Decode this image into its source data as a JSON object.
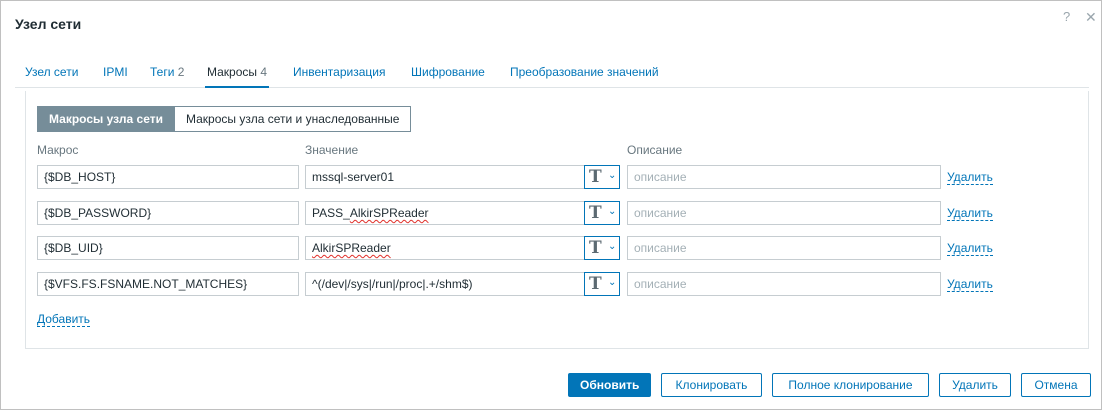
{
  "dialog": {
    "title": "Узел сети",
    "help_icon": "?",
    "close_icon": "✕"
  },
  "tabs": [
    {
      "label": "Узел сети"
    },
    {
      "label": "IPMI"
    },
    {
      "label": "Теги",
      "count": "2"
    },
    {
      "label": "Макросы",
      "count": "4",
      "active": true
    },
    {
      "label": "Инвентаризация"
    },
    {
      "label": "Шифрование"
    },
    {
      "label": "Преобразование значений"
    }
  ],
  "segmented": {
    "host_macros": "Макросы узла сети",
    "inherited_macros": "Макросы узла сети и унаследованные"
  },
  "columns": {
    "macro": "Макрос",
    "value": "Значение",
    "description": "Описание"
  },
  "rows": [
    {
      "macro": "{$DB_HOST}",
      "value": "mssql-server01",
      "description_placeholder": "описание",
      "remove": "Удалить"
    },
    {
      "macro": "{$DB_PASSWORD}",
      "value_pre": "PASS_",
      "value_err": "AlkirSPReader",
      "description_placeholder": "описание",
      "remove": "Удалить"
    },
    {
      "macro": "{$DB_UID}",
      "value_err": "AlkirSPReader",
      "description_placeholder": "описание",
      "remove": "Удалить"
    },
    {
      "macro": "{$VFS.FS.FSNAME.NOT_MATCHES}",
      "value": "^(/dev|/sys|/run|/proc|.+/shm$)",
      "description_placeholder": "описание",
      "remove": "Удалить"
    }
  ],
  "type_button": {
    "icon": "T",
    "chevron": "⌄"
  },
  "add_link": "Добавить",
  "footer": {
    "update": "Обновить",
    "clone": "Клонировать",
    "full_clone": "Полное клонирование",
    "delete": "Удалить",
    "cancel": "Отмена"
  },
  "colors": {
    "accent": "#0275b8",
    "segment_active": "#768d99",
    "error_underline": "#e0302a"
  }
}
